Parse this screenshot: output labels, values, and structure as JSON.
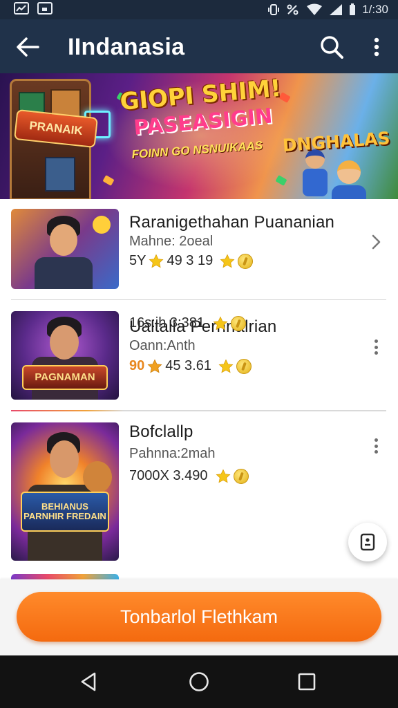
{
  "status_bar": {
    "time": "1/:30",
    "icons": [
      "activity-icon",
      "image-icon",
      "vibrate-icon",
      "wifi-icon",
      "signal-icon",
      "battery-icon"
    ]
  },
  "app_bar": {
    "title": "IIndanasia",
    "icons": [
      "back-arrow-icon",
      "search-icon",
      "more-vertical-icon"
    ]
  },
  "banner": {
    "title_line1": "GIOPI SHIM!",
    "title_line2": "PASEASIGIN",
    "subtitle": "FOINN GO NSNUIKAAS",
    "badge": "DNGHALAS",
    "machine_sign": "PRANAIK"
  },
  "games": [
    {
      "title": "Raranigethahan Puananian",
      "subtitle": "Mahne: 2oeal",
      "meta": "5Y ⭑49 3 19",
      "meta_prefix": "5Y",
      "meta_value": "49 3 19",
      "action": "chevron-right"
    },
    {
      "title": "Ualtalia Pernnalrian",
      "subtitle": "Oann:Anth",
      "meta_prefix": "90",
      "meta_value": "45 3.61",
      "action": "more-vertical"
    },
    {
      "title": "Bofclallp",
      "subtitle": "Pahnna:2mah",
      "meta_value": "7000X 3.490",
      "meta2_value": "16s:ih 3:381",
      "thumb_logo": "BEHIANUS PARNHIR FREDAIN",
      "action": "more-vertical"
    }
  ],
  "thumb_logos": {
    "game2": "PAGNAMAN"
  },
  "cta": {
    "label": "Tonbarlol Flethkam"
  },
  "colors": {
    "app_bar": "#20324a",
    "status_bar": "#1c2a3d",
    "accent_orange": "#f46a0f",
    "star_yellow": "#f5c518"
  },
  "nav": {
    "icons": [
      "back-triangle-icon",
      "home-circle-icon",
      "recents-square-icon"
    ]
  }
}
